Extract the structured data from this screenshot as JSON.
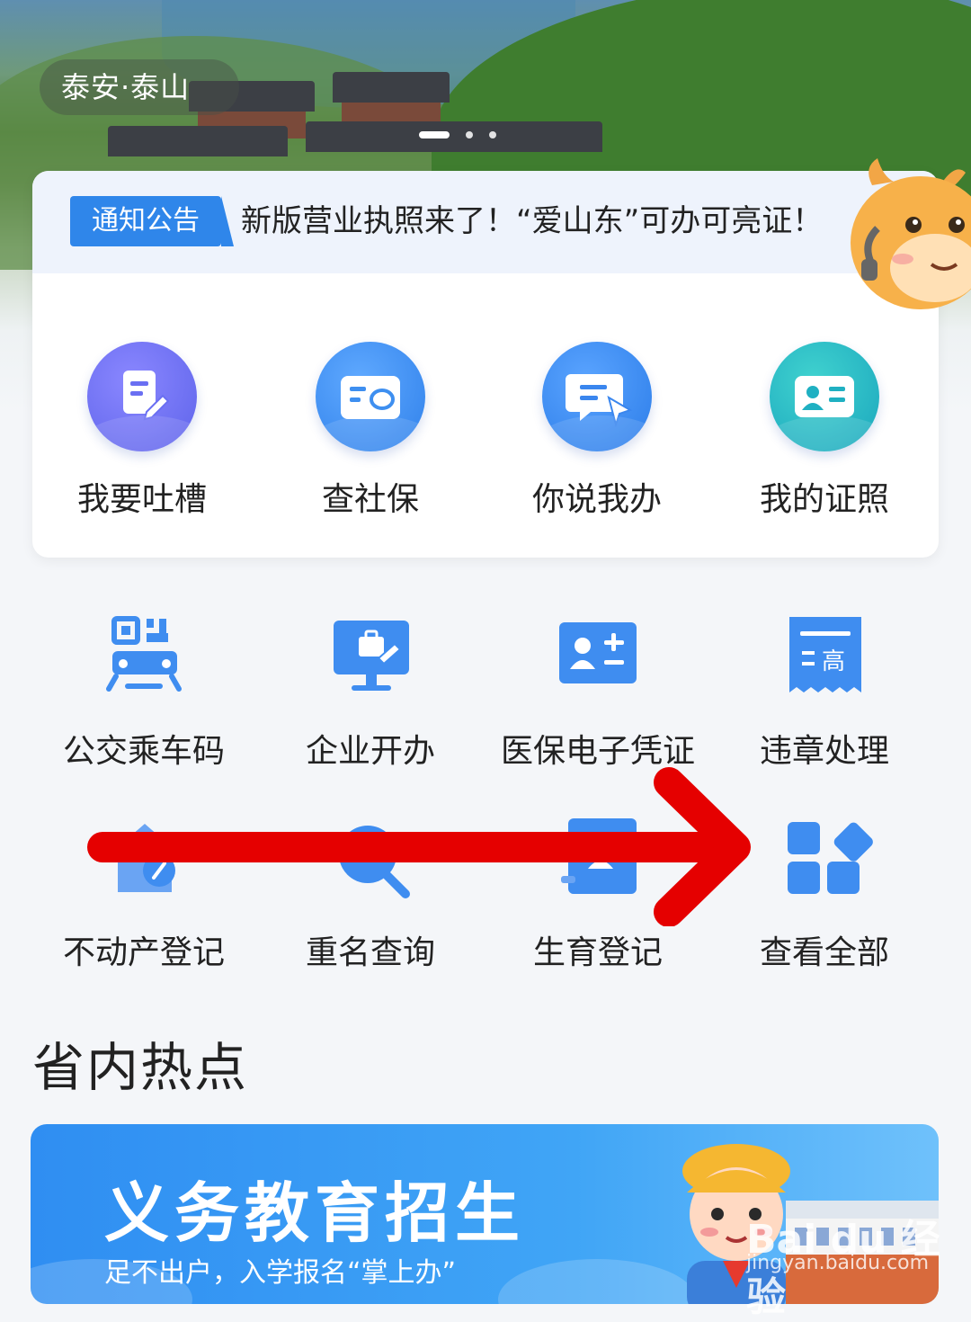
{
  "hero": {
    "location": "泰安·泰山",
    "carousel_total": 3,
    "carousel_active": 1
  },
  "notice": {
    "tag": "通知公告",
    "text": "新版营业执照来了！“爱山东”可办可亮证！"
  },
  "quick_services": [
    {
      "label": "我要吐槽",
      "icon": "edit-document-icon",
      "color": "#6a6ff2"
    },
    {
      "label": "查社保",
      "icon": "social-insurance-card-icon",
      "color": "#3e8ff0"
    },
    {
      "label": "你说我办",
      "icon": "chat-pointer-icon",
      "color": "#3a86ee"
    },
    {
      "label": "我的证照",
      "icon": "id-card-icon",
      "color": "#25b7c6"
    }
  ],
  "services": [
    {
      "label": "公交乘车码",
      "icon": "bus-qr-icon"
    },
    {
      "label": "企业开办",
      "icon": "enterprise-monitor-icon"
    },
    {
      "label": "医保电子凭证",
      "icon": "medical-id-icon"
    },
    {
      "label": "违章处理",
      "icon": "traffic-ticket-icon"
    },
    {
      "label": "不动产登记",
      "icon": "property-register-icon"
    },
    {
      "label": "重名查询",
      "icon": "name-search-icon"
    },
    {
      "label": "生育登记",
      "icon": "birth-register-icon"
    },
    {
      "label": "查看全部",
      "icon": "grid-all-icon"
    }
  ],
  "section": {
    "title": "省内热点"
  },
  "banner": {
    "title": "义务教育招生",
    "subtitle": "足不出户，入学报名“掌上办”"
  },
  "watermark": {
    "brand": "Bai du 经验",
    "url": "jingyan.baidu.com"
  },
  "colors": {
    "primary": "#2f86ea",
    "annotation_arrow": "#e50000"
  }
}
